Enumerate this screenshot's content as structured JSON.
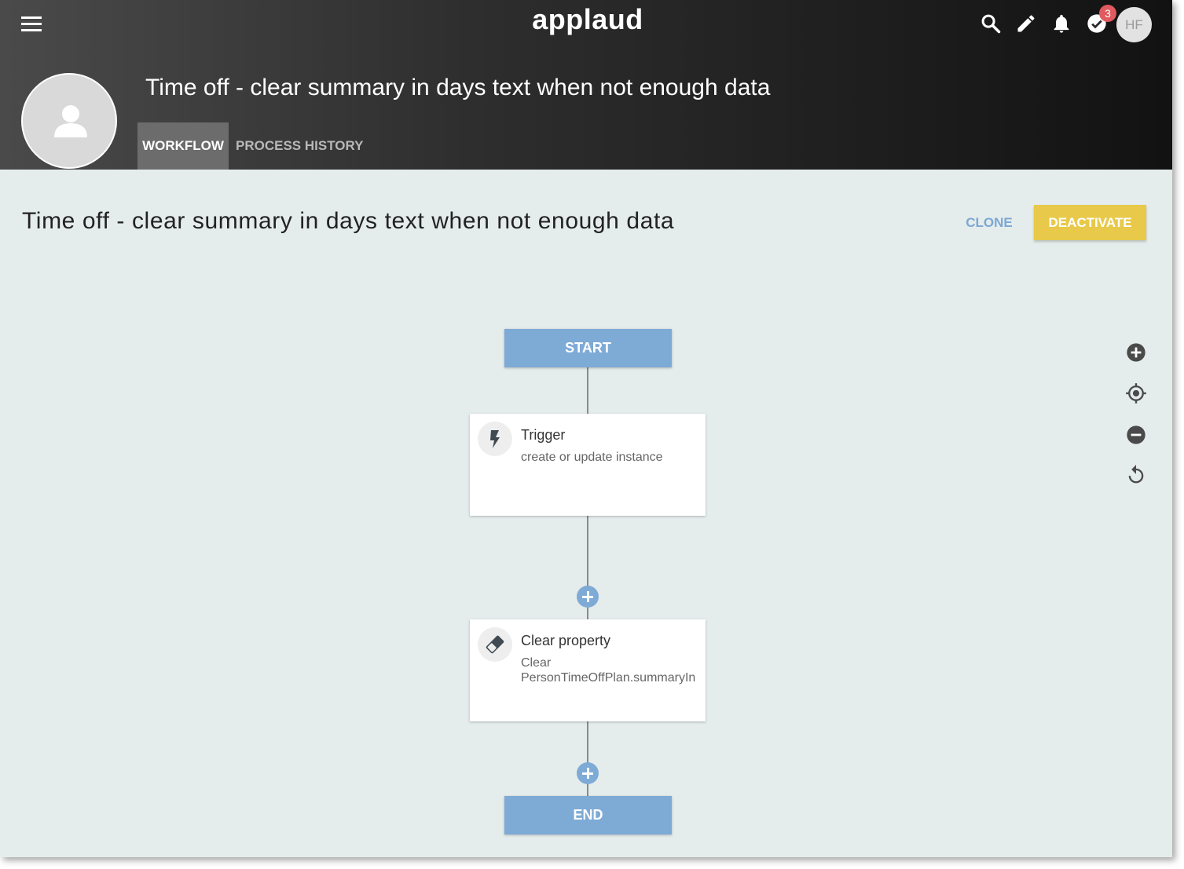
{
  "app": {
    "logo": "applaud"
  },
  "header": {
    "notifications_badge": "3",
    "user_initials": "HF",
    "title": "Time off - clear summary in days text when not enough data",
    "tabs": [
      {
        "label": "WORKFLOW",
        "active": true
      },
      {
        "label": "PROCESS HISTORY",
        "active": false
      }
    ]
  },
  "page": {
    "title": "Time off - clear summary in days text when not enough data",
    "clone_label": "CLONE",
    "deactivate_label": "DEACTIVATE"
  },
  "workflow": {
    "start_label": "START",
    "end_label": "END",
    "steps": [
      {
        "icon": "lightning-icon",
        "title": "Trigger",
        "subtitle": "create or update instance"
      },
      {
        "icon": "eraser-icon",
        "title": "Clear property",
        "subtitle": "Clear PersonTimeOffPlan.summaryIn"
      }
    ]
  },
  "zoom_controls": [
    "zoom-in-icon",
    "recenter-icon",
    "zoom-out-icon",
    "reset-icon"
  ],
  "colors": {
    "accent_blue": "#7eaad6",
    "deactivate_yellow": "#e8c94a",
    "badge_red": "#e05a5f",
    "canvas_bg": "#e5ecec"
  }
}
